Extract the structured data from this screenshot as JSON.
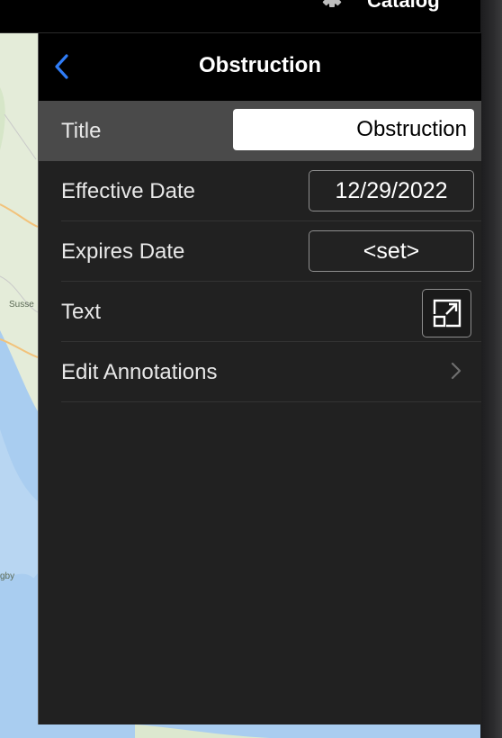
{
  "toolbar": {
    "settings_icon": "gear-icon",
    "catalog_label": "Catalog"
  },
  "map": {
    "labels": [
      "Susse",
      "gby"
    ]
  },
  "panel": {
    "title": "Obstruction",
    "back_icon": "chevron-left-icon",
    "rows": {
      "title": {
        "label": "Title",
        "value": "Obstruction"
      },
      "effective_date": {
        "label": "Effective Date",
        "value": "12/29/2022"
      },
      "expires_date": {
        "label": "Expires Date",
        "value": "<set>"
      },
      "text": {
        "label": "Text",
        "icon": "expand-icon"
      },
      "edit_annotations": {
        "label": "Edit Annotations",
        "icon": "chevron-right-icon"
      }
    }
  },
  "colors": {
    "accent": "#2f7cf6",
    "panel_bg": "#212121",
    "nav_bg": "#000000",
    "selected_row_bg": "#4a4a4a",
    "map_land": "#e4ecd9",
    "map_water": "#a9cdf0"
  }
}
